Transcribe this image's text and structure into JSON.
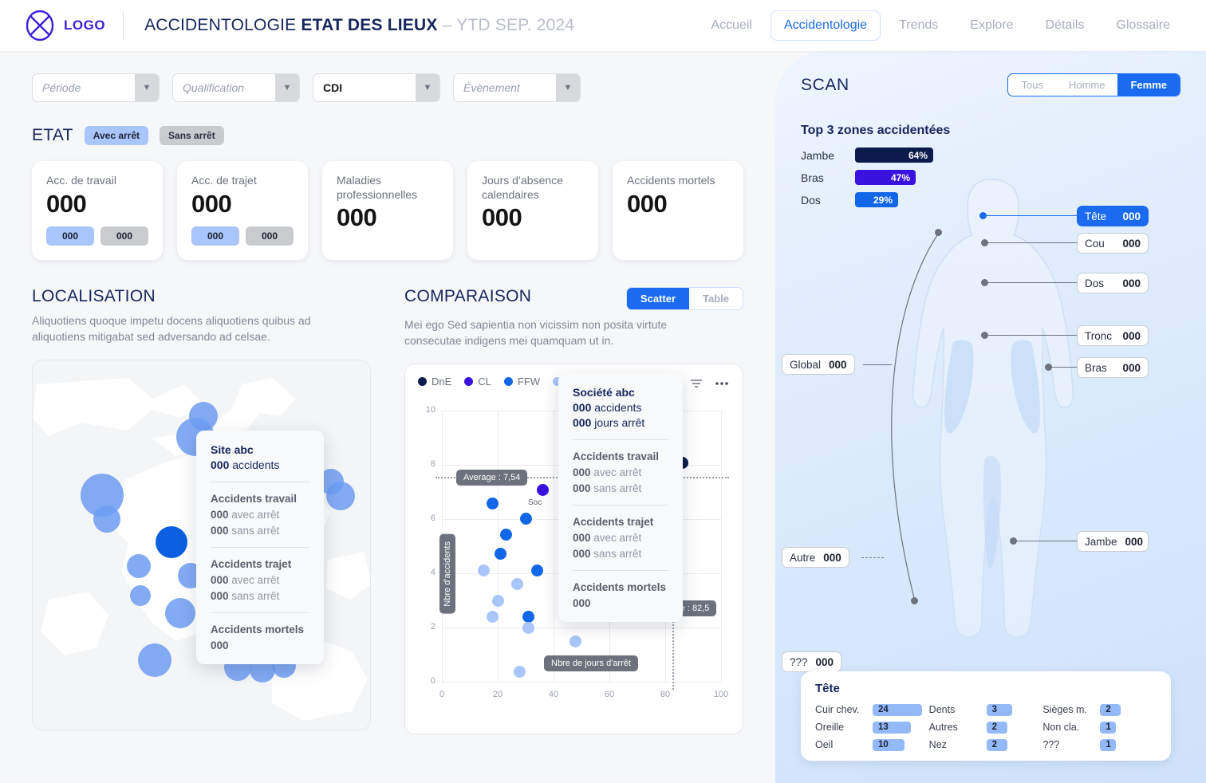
{
  "header": {
    "logo_text": "LOGO",
    "title_plain": "ACCIDENTOLOGIE ",
    "title_bold": "ETAT DES LIEUX",
    "title_muted": " – YTD SEP. 2024",
    "nav": [
      {
        "label": "Accueil",
        "active": false
      },
      {
        "label": "Accidentologie",
        "active": true
      },
      {
        "label": "Trends",
        "active": false
      },
      {
        "label": "Explore",
        "active": false
      },
      {
        "label": "Détails",
        "active": false
      },
      {
        "label": "Glossaire",
        "active": false
      }
    ]
  },
  "filters": [
    {
      "value": "Période",
      "filled": false
    },
    {
      "value": "Qualification",
      "filled": false
    },
    {
      "value": "CDI",
      "filled": true
    },
    {
      "value": "Évènement",
      "filled": false
    }
  ],
  "etat": {
    "title": "ETAT",
    "pills": [
      {
        "label": "Avec arrêt",
        "style": "blue"
      },
      {
        "label": "Sans arrêt",
        "style": "grey"
      }
    ],
    "kpis": [
      {
        "label": "Acc. de travail",
        "value": "000",
        "chips": [
          "000",
          "000"
        ]
      },
      {
        "label": "Acc. de trajet",
        "value": "000",
        "chips": [
          "000",
          "000"
        ]
      },
      {
        "label": "Maladies professionnelles",
        "value": "000",
        "chips": []
      },
      {
        "label": "Jours d’absence calendaires",
        "value": "000",
        "chips": []
      },
      {
        "label": "Accidents mortels",
        "value": "000",
        "chips": []
      }
    ]
  },
  "localisation": {
    "title": "LOCALISATION",
    "desc": "Aliquotiens quoque impetu docens aliquotiens quibus ad aliquotiens mitigabat sed adversando ad celsae.",
    "tooltip": {
      "title": "Site abc",
      "line1_num": "000",
      "line1_txt": " accidents",
      "sec1_head": "Accidents travail",
      "sec1_r1_num": "000",
      "sec1_r1_txt": " avec arrêt",
      "sec1_r2_num": "000",
      "sec1_r2_txt": " sans arrêt",
      "sec2_head": "Accidents trajet",
      "sec2_r1_num": "000",
      "sec2_r1_txt": " avec arrêt",
      "sec2_r2_num": "000",
      "sec2_r2_txt": " sans arrêt",
      "sec3_head": "Accidents mortels",
      "sec3_val": "000"
    }
  },
  "comparaison": {
    "title": "COMPARAISON",
    "desc": "Mei ego Sed sapientia non vicissim non posita virtute consecutae indigens mei quamquam ut in.",
    "toggles": [
      {
        "label": "Scatter",
        "active": true
      },
      {
        "label": "Table",
        "active": false
      }
    ],
    "tooltip": {
      "title": "Société abc",
      "line1_num": "000",
      "line1_txt": " accidents",
      "line2_num": "000",
      "line2_txt": " jours arrêt",
      "sec1_head": "Accidents travail",
      "sec1_r1_num": "000",
      "sec1_r1_txt": " avec arrêt",
      "sec1_r2_num": "000",
      "sec1_r2_txt": " sans arrêt",
      "sec2_head": "Accidents trajet",
      "sec2_r1_num": "000",
      "sec2_r1_txt": " avec arrêt",
      "sec2_r2_num": "000",
      "sec2_r2_txt": " sans arrêt",
      "sec3_head": "Accidents mortels",
      "sec3_val": "000"
    },
    "point_label": "Soc"
  },
  "chart_data": {
    "type": "scatter",
    "title": "",
    "xlabel": "Nbre de jours d'arrêt",
    "ylabel": "Nbre d'accidents",
    "xlim": [
      0,
      100
    ],
    "ylim": [
      0,
      10
    ],
    "xticks": [
      0,
      20,
      40,
      60,
      80,
      100
    ],
    "yticks": [
      0,
      2,
      4,
      6,
      8,
      10
    ],
    "grid": true,
    "legend_position": "top-left",
    "legend": [
      {
        "name": "DnE",
        "color": "#0d1b4c"
      },
      {
        "name": "CL",
        "color": "#3a12e0"
      },
      {
        "name": "FFW",
        "color": "#1267e8"
      },
      {
        "name": "RT",
        "color": "#a8c6fb"
      }
    ],
    "average_x": 82.5,
    "average_y": 7.54,
    "average_x_label": "Average : 82,5",
    "average_y_label": "Average : 7,54",
    "points": [
      {
        "x": 86,
        "y": 7.8,
        "series": "DnE"
      },
      {
        "x": 36,
        "y": 6.8,
        "series": "CL"
      },
      {
        "x": 18,
        "y": 6.3,
        "series": "FFW"
      },
      {
        "x": 30,
        "y": 5.9,
        "series": "FFW"
      },
      {
        "x": 23,
        "y": 5.4,
        "series": "FFW"
      },
      {
        "x": 21,
        "y": 4.7,
        "series": "FFW"
      },
      {
        "x": 34,
        "y": 4.1,
        "series": "FFW"
      },
      {
        "x": 15,
        "y": 4.1,
        "series": "RT"
      },
      {
        "x": 27,
        "y": 3.6,
        "series": "RT"
      },
      {
        "x": 20,
        "y": 3.0,
        "series": "RT"
      },
      {
        "x": 18,
        "y": 2.4,
        "series": "RT"
      },
      {
        "x": 31,
        "y": 2.4,
        "series": "FFW"
      },
      {
        "x": 31,
        "y": 2.0,
        "series": "RT"
      },
      {
        "x": 48,
        "y": 1.5,
        "series": "RT"
      },
      {
        "x": 44,
        "y": 0.7,
        "series": "RT"
      },
      {
        "x": 28,
        "y": 0.4,
        "series": "RT"
      }
    ]
  },
  "scan": {
    "title": "SCAN",
    "segments": [
      {
        "label": "Tous",
        "active": false
      },
      {
        "label": "Homme",
        "active": false
      },
      {
        "label": "Femme",
        "active": true
      }
    ],
    "top3_title": "Top 3 zones accidentées",
    "top3": [
      {
        "label": "Jambe",
        "pct": 64,
        "text": "64%",
        "color": "#0d1b4c"
      },
      {
        "label": "Bras",
        "pct": 47,
        "text": "47%",
        "color": "#3a12e0"
      },
      {
        "label": "Dos",
        "pct": 29,
        "text": "29%",
        "color": "#1267e8"
      }
    ],
    "zones": [
      {
        "name": "Tête",
        "value": "000",
        "active": true
      },
      {
        "name": "Cou",
        "value": "000",
        "active": false
      },
      {
        "name": "Dos",
        "value": "000",
        "active": false
      },
      {
        "name": "Tronc",
        "value": "000",
        "active": false
      },
      {
        "name": "Bras",
        "value": "000",
        "active": false
      },
      {
        "name": "Jambe",
        "value": "000",
        "active": false
      },
      {
        "name": "Global",
        "value": "000",
        "active": false
      },
      {
        "name": "Autre",
        "value": "000",
        "active": false
      },
      {
        "name": "???",
        "value": "000",
        "active": false
      }
    ],
    "detail": {
      "title": "Tête",
      "columns": [
        [
          {
            "label": "Cuir chev.",
            "value": "24",
            "w": 62
          },
          {
            "label": "Oreille",
            "value": "13",
            "w": 48
          },
          {
            "label": "Oeil",
            "value": "10",
            "w": 40
          }
        ],
        [
          {
            "label": "Dents",
            "value": "3",
            "w": 32
          },
          {
            "label": "Autres",
            "value": "2",
            "w": 26
          },
          {
            "label": "Nez",
            "value": "2",
            "w": 26
          }
        ],
        [
          {
            "label": "Sièges m.",
            "value": "2",
            "w": 26
          },
          {
            "label": "Non cla.",
            "value": "1",
            "w": 20
          },
          {
            "label": "???",
            "value": "1",
            "w": 20
          }
        ]
      ]
    }
  }
}
